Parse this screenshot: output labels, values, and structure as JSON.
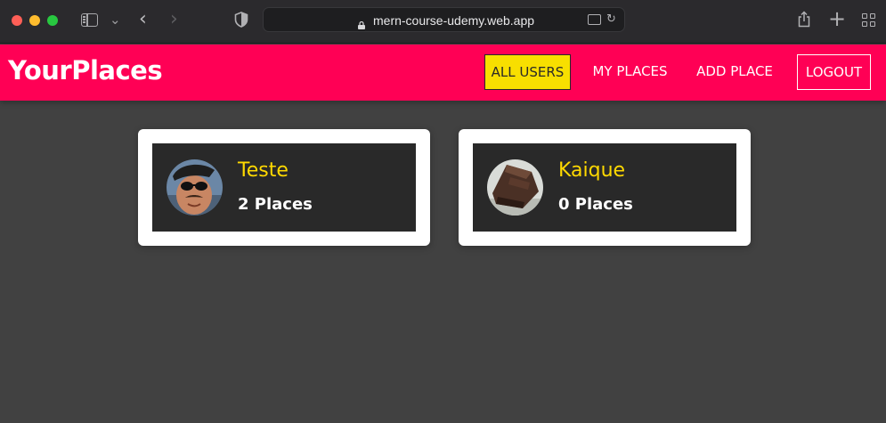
{
  "browser": {
    "url": "mern-course-udemy.web.app",
    "icons": [
      "sidebar-icon",
      "chevron-down-icon",
      "back-arrow-icon",
      "forward-arrow-icon",
      "shield-icon",
      "lock-icon",
      "translate-icon",
      "reload-icon",
      "share-icon",
      "plus-icon",
      "tab-overview-icon"
    ]
  },
  "header": {
    "logo": "YourPlaces",
    "nav": {
      "all_users": "ALL USERS",
      "my_places": "MY PLACES",
      "add_place": "ADD PLACE",
      "logout": "LOGOUT"
    },
    "colors": {
      "brand": "#ff0055",
      "active_nav": "#f8df00"
    }
  },
  "users": [
    {
      "name": "Teste",
      "places": "2 Places",
      "avatar": "avatar-man-with-beret-and-sunglasses"
    },
    {
      "name": "Kaique",
      "places": "0 Places",
      "avatar": "avatar-chocolate-cake"
    }
  ],
  "colors": {
    "page_bg": "#414141",
    "card_inner": "#292929",
    "user_name": "#ffd900"
  }
}
